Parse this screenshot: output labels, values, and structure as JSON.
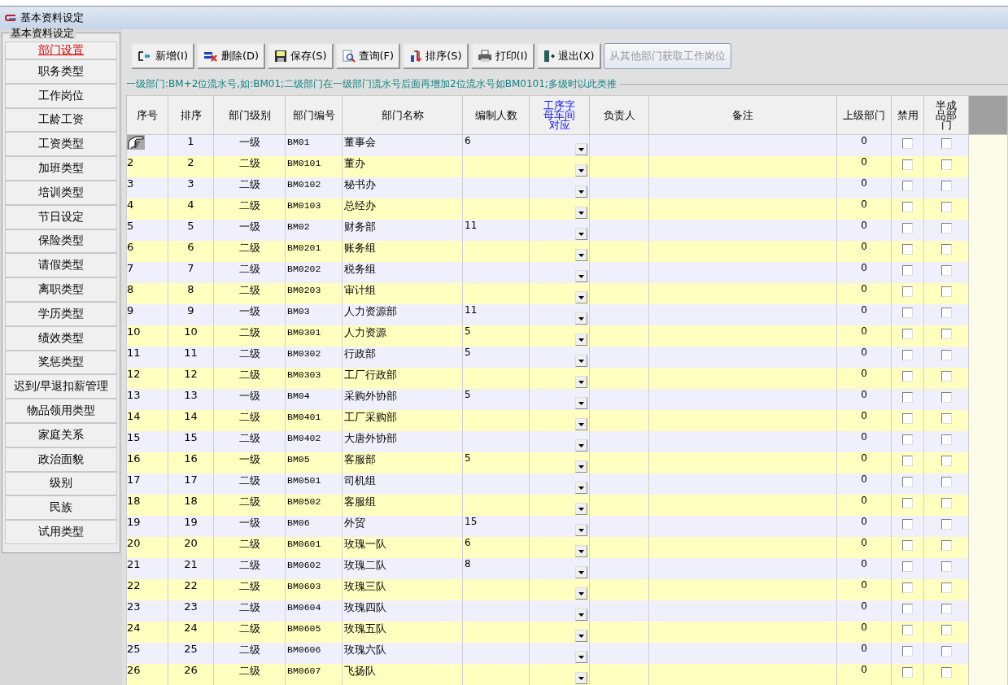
{
  "window": {
    "title": "基本资料设定"
  },
  "sidebar": {
    "title": "基本资料设定",
    "items": [
      {
        "label": "部门设置",
        "selected": true
      },
      {
        "label": "职务类型",
        "selected": false
      },
      {
        "label": "工作岗位",
        "selected": false
      },
      {
        "label": "工龄工资",
        "selected": false
      },
      {
        "label": "工资类型",
        "selected": false
      },
      {
        "label": "加班类型",
        "selected": false
      },
      {
        "label": "培训类型",
        "selected": false
      },
      {
        "label": "节日设定",
        "selected": false
      },
      {
        "label": "保险类型",
        "selected": false
      },
      {
        "label": "请假类型",
        "selected": false
      },
      {
        "label": "离职类型",
        "selected": false
      },
      {
        "label": "学历类型",
        "selected": false
      },
      {
        "label": "绩效类型",
        "selected": false
      },
      {
        "label": "奖惩类型",
        "selected": false
      },
      {
        "label": "迟到/早退扣薪管理",
        "selected": false
      },
      {
        "label": "物品领用类型",
        "selected": false
      },
      {
        "label": "家庭关系",
        "selected": false
      },
      {
        "label": "政治面貌",
        "selected": false
      },
      {
        "label": "级别",
        "selected": false
      },
      {
        "label": "民族",
        "selected": false
      },
      {
        "label": "试用类型",
        "selected": false
      }
    ]
  },
  "toolbar": [
    {
      "label": "新增(I)",
      "kind": "add",
      "disabled": false
    },
    {
      "label": "删除(D)",
      "kind": "delete",
      "disabled": false
    },
    {
      "label": "保存(S)",
      "kind": "save",
      "disabled": false
    },
    {
      "label": "查询(F)",
      "kind": "search",
      "disabled": false
    },
    {
      "label": "排序(S)",
      "kind": "sort",
      "disabled": false
    },
    {
      "label": "打印(I)",
      "kind": "print",
      "disabled": false
    },
    {
      "label": "退出(X)",
      "kind": "exit",
      "disabled": false
    },
    {
      "label": "从其他部门获取工作岗位",
      "kind": "text",
      "disabled": true
    }
  ],
  "hint": "一级部门:BM+2位流水号,如:BM01;二级部门在一级部门流水号后面再增加2位流水号如BM0101;多级时以此类推",
  "table": {
    "columns": [
      "序号",
      "排序",
      "部门级别",
      "部门编号",
      "部门名称",
      "编制人数",
      "工序字母车间对应",
      "负责人",
      "备注",
      "上级部门",
      "禁用",
      "半成品部门"
    ],
    "rows": [
      {
        "selected": true,
        "order": "1",
        "level": "一级",
        "code": "BM01",
        "name": "董事会",
        "headcount": "6",
        "parent": "0",
        "disabled": false,
        "semi": false
      },
      {
        "selected": false,
        "index": "2",
        "order": "2",
        "level": "二级",
        "code": "BM0101",
        "name": "董办",
        "parent": "0",
        "disabled": false,
        "semi": false
      },
      {
        "selected": false,
        "index": "3",
        "order": "3",
        "level": "二级",
        "code": "BM0102",
        "name": "秘书办",
        "parent": "0",
        "disabled": false,
        "semi": false
      },
      {
        "selected": false,
        "index": "4",
        "order": "4",
        "level": "二级",
        "code": "BM0103",
        "name": "总经办",
        "parent": "0",
        "disabled": false,
        "semi": false
      },
      {
        "selected": false,
        "index": "5",
        "order": "5",
        "level": "一级",
        "code": "BM02",
        "name": "财务部",
        "headcount": "11",
        "parent": "0",
        "disabled": false,
        "semi": false
      },
      {
        "selected": false,
        "index": "6",
        "order": "6",
        "level": "二级",
        "code": "BM0201",
        "name": "账务组",
        "parent": "0",
        "disabled": false,
        "semi": false
      },
      {
        "selected": false,
        "index": "7",
        "order": "7",
        "level": "二级",
        "code": "BM0202",
        "name": "税务组",
        "parent": "0",
        "disabled": false,
        "semi": false
      },
      {
        "selected": false,
        "index": "8",
        "order": "8",
        "level": "二级",
        "code": "BM0203",
        "name": "审计组",
        "parent": "0",
        "disabled": false,
        "semi": false
      },
      {
        "selected": false,
        "index": "9",
        "order": "9",
        "level": "一级",
        "code": "BM03",
        "name": "人力资源部",
        "headcount": "11",
        "parent": "0",
        "disabled": false,
        "semi": false
      },
      {
        "selected": false,
        "index": "10",
        "order": "10",
        "level": "二级",
        "code": "BM0301",
        "name": "人力资源",
        "headcount": "5",
        "parent": "0",
        "disabled": false,
        "semi": false
      },
      {
        "selected": false,
        "index": "11",
        "order": "11",
        "level": "二级",
        "code": "BM0302",
        "name": "行政部",
        "headcount": "5",
        "parent": "0",
        "disabled": false,
        "semi": false
      },
      {
        "selected": false,
        "index": "12",
        "order": "12",
        "level": "二级",
        "code": "BM0303",
        "name": "工厂行政部",
        "parent": "0",
        "disabled": false,
        "semi": false
      },
      {
        "selected": false,
        "index": "13",
        "order": "13",
        "level": "一级",
        "code": "BM04",
        "name": "采购外协部",
        "headcount": "5",
        "parent": "0",
        "disabled": false,
        "semi": false
      },
      {
        "selected": false,
        "index": "14",
        "order": "14",
        "level": "二级",
        "code": "BM0401",
        "name": "工厂采购部",
        "parent": "0",
        "disabled": false,
        "semi": false
      },
      {
        "selected": false,
        "index": "15",
        "order": "15",
        "level": "二级",
        "code": "BM0402",
        "name": "大唐外协部",
        "parent": "0",
        "disabled": false,
        "semi": false
      },
      {
        "selected": false,
        "index": "16",
        "order": "16",
        "level": "一级",
        "code": "BM05",
        "name": "客服部",
        "headcount": "5",
        "parent": "0",
        "disabled": false,
        "semi": false
      },
      {
        "selected": false,
        "index": "17",
        "order": "17",
        "level": "二级",
        "code": "BM0501",
        "name": "司机组",
        "parent": "0",
        "disabled": false,
        "semi": false
      },
      {
        "selected": false,
        "index": "18",
        "order": "18",
        "level": "二级",
        "code": "BM0502",
        "name": "客服组",
        "parent": "0",
        "disabled": false,
        "semi": false
      },
      {
        "selected": false,
        "index": "19",
        "order": "19",
        "level": "一级",
        "code": "BM06",
        "name": "外贸",
        "headcount": "15",
        "parent": "0",
        "disabled": false,
        "semi": false
      },
      {
        "selected": false,
        "index": "20",
        "order": "20",
        "level": "二级",
        "code": "BM0601",
        "name": "玫瑰一队",
        "headcount": "6",
        "parent": "0",
        "disabled": false,
        "semi": false
      },
      {
        "selected": false,
        "index": "21",
        "order": "21",
        "level": "二级",
        "code": "BM0602",
        "name": "玫瑰二队",
        "headcount": "8",
        "parent": "0",
        "disabled": false,
        "semi": false
      },
      {
        "selected": false,
        "index": "22",
        "order": "22",
        "level": "二级",
        "code": "BM0603",
        "name": "玫瑰三队",
        "parent": "0",
        "disabled": false,
        "semi": false
      },
      {
        "selected": false,
        "index": "23",
        "order": "23",
        "level": "二级",
        "code": "BM0604",
        "name": "玫瑰四队",
        "parent": "0",
        "disabled": false,
        "semi": false
      },
      {
        "selected": false,
        "index": "24",
        "order": "24",
        "level": "二级",
        "code": "BM0605",
        "name": "玫瑰五队",
        "parent": "0",
        "disabled": false,
        "semi": false
      },
      {
        "selected": false,
        "index": "25",
        "order": "25",
        "level": "二级",
        "code": "BM0606",
        "name": "玫瑰六队",
        "parent": "0",
        "disabled": false,
        "semi": false
      },
      {
        "selected": false,
        "index": "26",
        "order": "26",
        "level": "二级",
        "code": "BM0607",
        "name": "飞扬队",
        "parent": "0",
        "disabled": false,
        "semi": false
      }
    ]
  }
}
